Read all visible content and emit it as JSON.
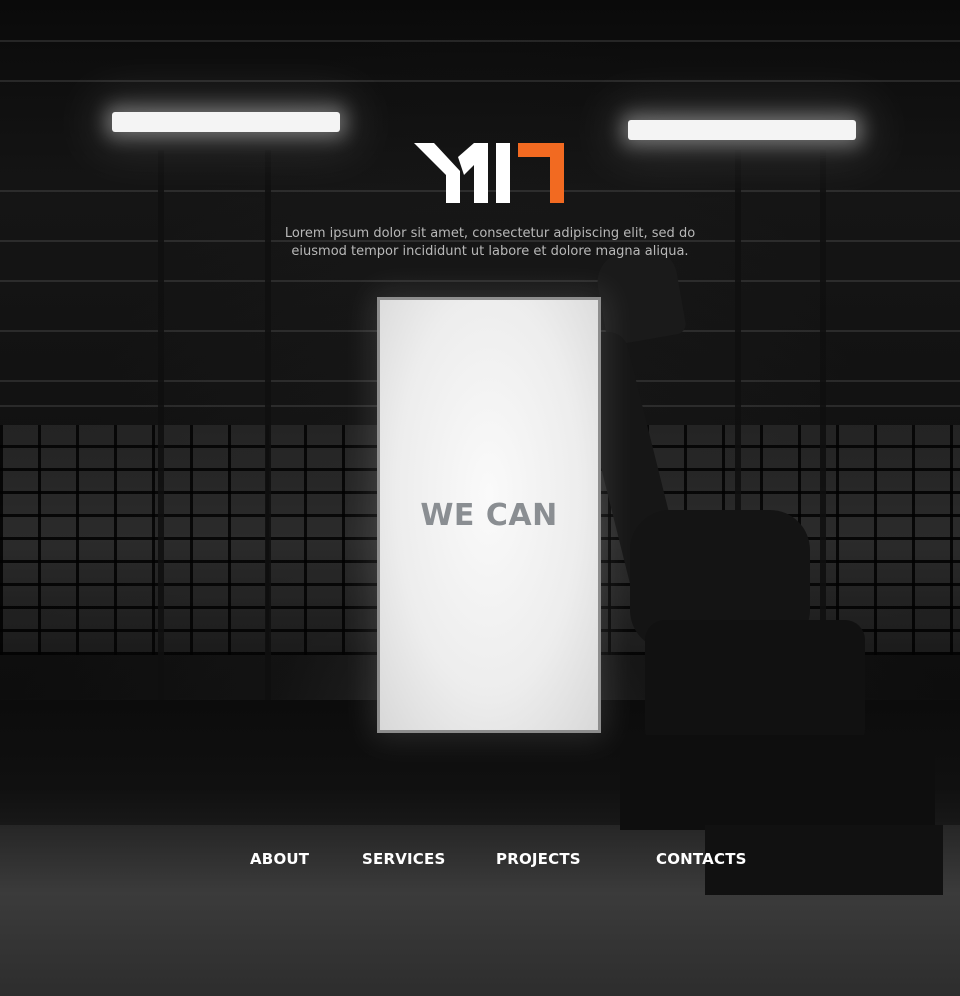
{
  "brand": {
    "logo_text": "MI7",
    "accent_color": "#f26a21",
    "logo_color": "#ffffff"
  },
  "hero": {
    "tagline_line1": "Lorem ipsum dolor sit amet, consectetur adipiscing elit, sed do",
    "tagline_line2": "eiusmod tempor incididunt ut labore et dolore magna aliqua.",
    "lightbox_title": "WE CAN"
  },
  "nav": {
    "items": [
      {
        "label": "ABOUT"
      },
      {
        "label": "SERVICES"
      },
      {
        "label": "PROJECTS"
      },
      {
        "label": "CONTACTS"
      }
    ]
  }
}
